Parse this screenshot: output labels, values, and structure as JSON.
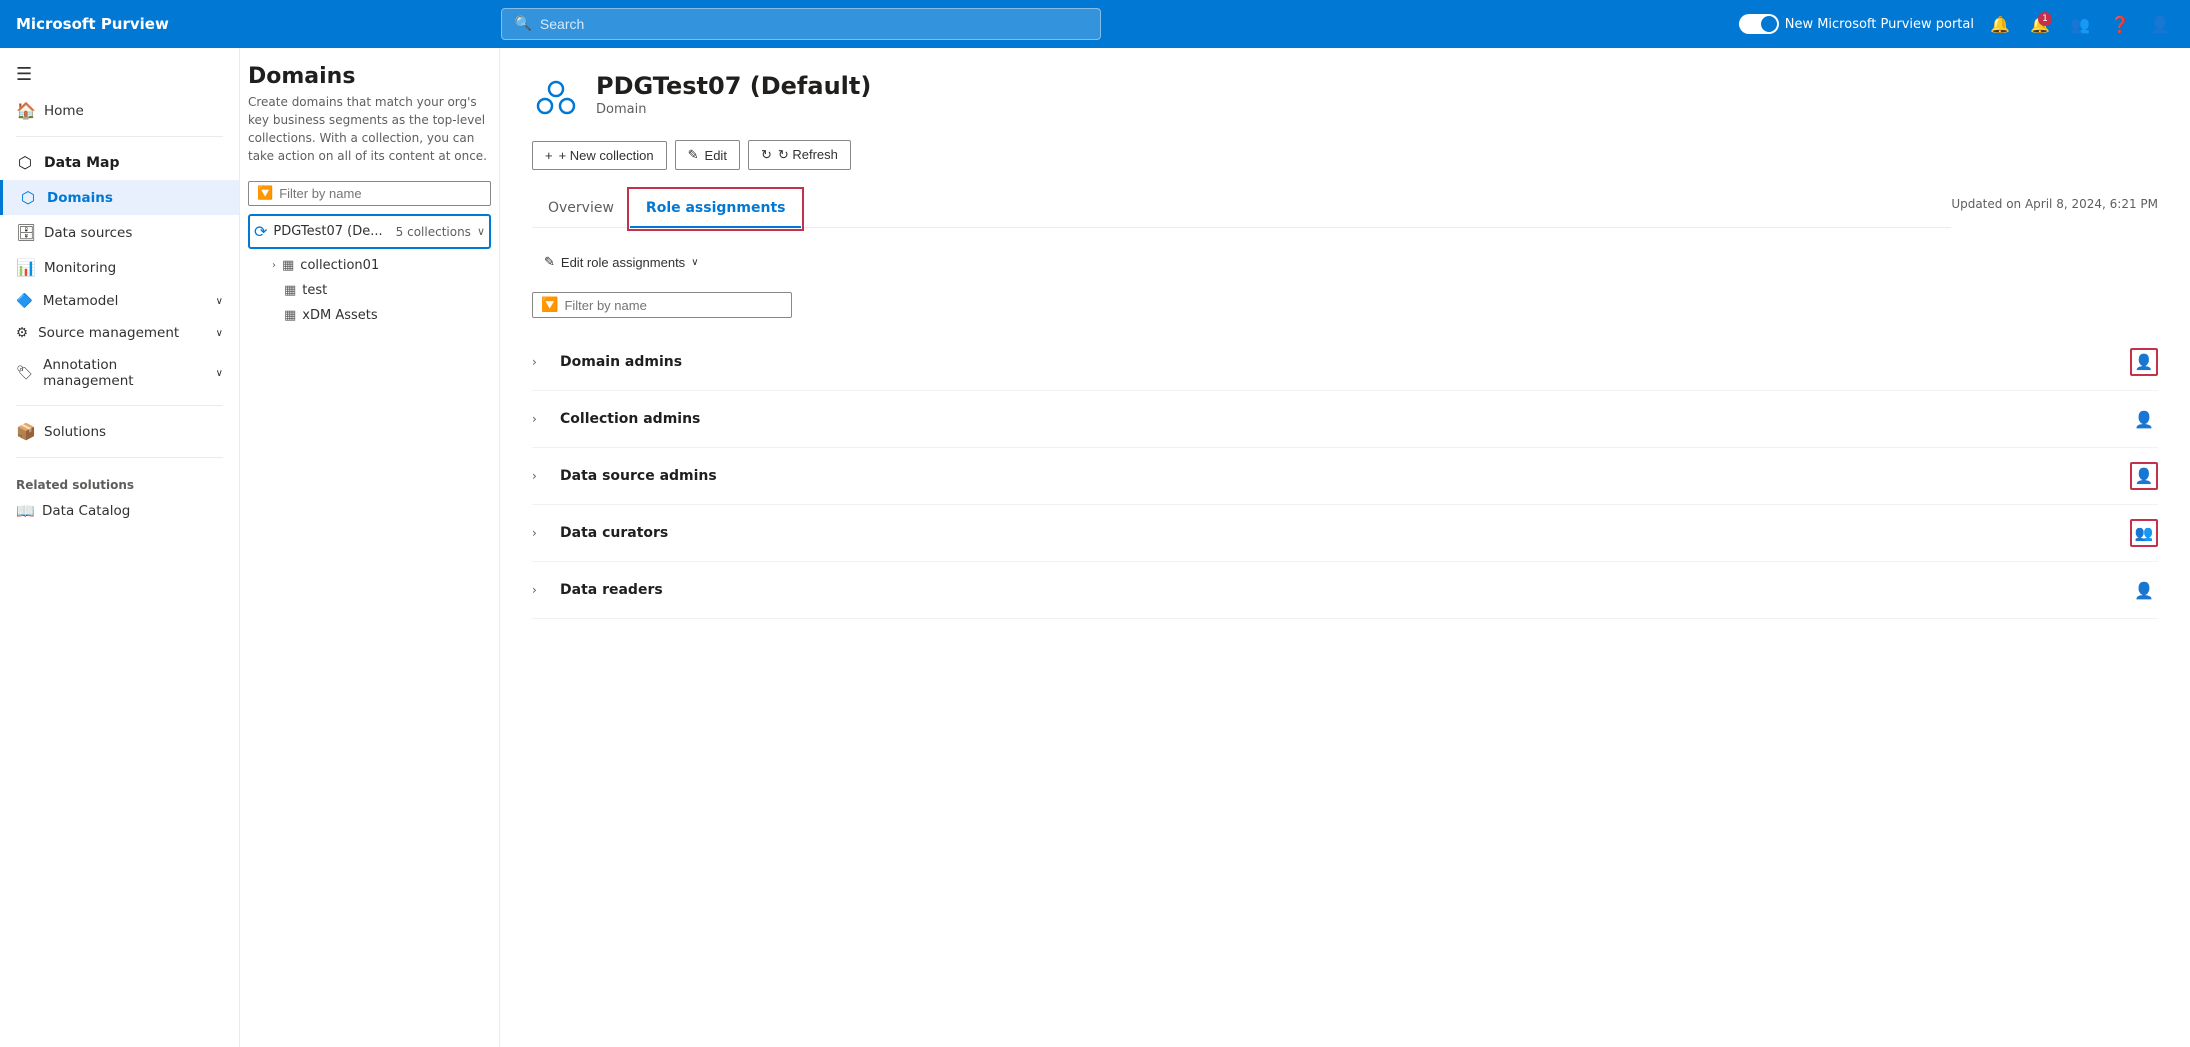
{
  "brand": {
    "name": "Microsoft Purview"
  },
  "topnav": {
    "search_placeholder": "Search",
    "toggle_label": "New Microsoft Purview portal",
    "notification_badge": "1"
  },
  "sidebar": {
    "hamburger": "☰",
    "items": [
      {
        "id": "home",
        "label": "Home",
        "icon": "🏠"
      },
      {
        "id": "data-map",
        "label": "Data Map",
        "icon": "⬡",
        "type": "section"
      },
      {
        "id": "domains",
        "label": "Domains",
        "icon": "⬡",
        "active": true
      },
      {
        "id": "data-sources",
        "label": "Data sources",
        "icon": "🗄"
      },
      {
        "id": "monitoring",
        "label": "Monitoring",
        "icon": "📊"
      },
      {
        "id": "metamodel",
        "label": "Metamodel",
        "icon": "🔷",
        "expandable": true
      },
      {
        "id": "source-management",
        "label": "Source management",
        "icon": "⚙",
        "expandable": true
      },
      {
        "id": "annotation-management",
        "label": "Annotation management",
        "icon": "🏷",
        "expandable": true
      },
      {
        "id": "solutions",
        "label": "Solutions",
        "icon": "📦"
      }
    ],
    "related_solutions_header": "Related solutions",
    "related_items": [
      {
        "id": "data-catalog",
        "label": "Data Catalog",
        "icon": "📖"
      }
    ]
  },
  "domains_panel": {
    "filter_placeholder": "Filter by name",
    "domain": {
      "name": "PDGTest07 (De...",
      "collections_count": "5 collections",
      "children": [
        {
          "name": "collection01",
          "icon": "▦"
        },
        {
          "name": "test",
          "icon": "▦"
        },
        {
          "name": "xDM Assets",
          "icon": "▦"
        }
      ]
    }
  },
  "detail": {
    "icon": "☁",
    "title": "PDGTest07 (Default)",
    "subtitle": "Domain",
    "actions": {
      "new_collection": "+ New collection",
      "edit": "✎ Edit",
      "refresh": "↻ Refresh"
    },
    "tabs": [
      {
        "id": "overview",
        "label": "Overview",
        "active": false
      },
      {
        "id": "role-assignments",
        "label": "Role assignments",
        "active": true
      }
    ],
    "updated": "Updated on April 8, 2024, 6:21 PM",
    "role_assignments": {
      "edit_btn": "Edit role assignments",
      "filter_placeholder": "Filter by name",
      "roles": [
        {
          "id": "domain-admins",
          "name": "Domain admins",
          "icon_type": "outlined_red"
        },
        {
          "id": "collection-admins",
          "name": "Collection admins",
          "icon_type": "plain"
        },
        {
          "id": "data-source-admins",
          "name": "Data source admins",
          "icon_type": "outlined_red"
        },
        {
          "id": "data-curators",
          "name": "Data curators",
          "icon_type": "outlined_red"
        },
        {
          "id": "data-readers",
          "name": "Data readers",
          "icon_type": "plain"
        }
      ]
    }
  }
}
